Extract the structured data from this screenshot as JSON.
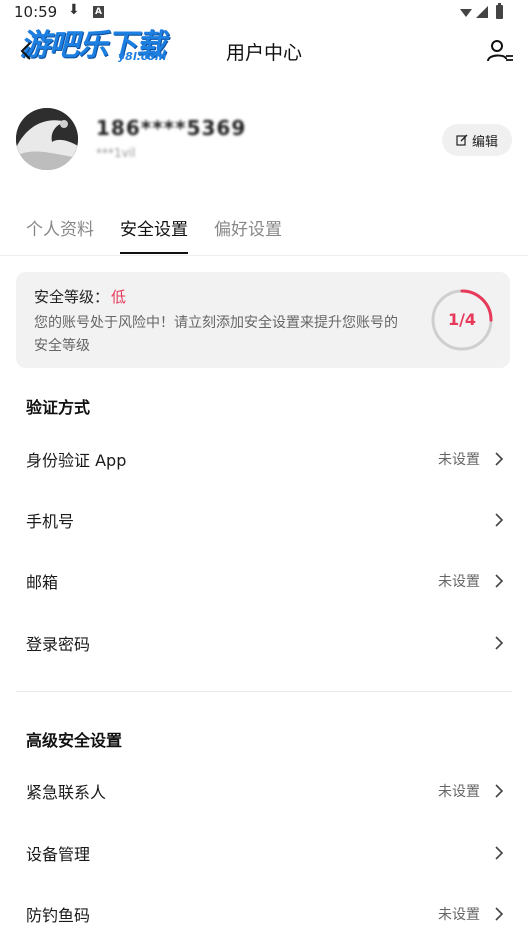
{
  "status_bar": {
    "time": "10:59",
    "download_icon": "download-icon",
    "notification_icon": "a-icon"
  },
  "watermark": {
    "main": "游吧乐下载",
    "sub": "y8l.com"
  },
  "header": {
    "title": "用户中心",
    "back_icon": "back-icon",
    "user_switch_icon": "user-switch-icon"
  },
  "profile": {
    "name": "186****5369",
    "sub": "***1vil",
    "edit_label": "编辑"
  },
  "tabs": [
    {
      "label": "个人资料",
      "active": false
    },
    {
      "label": "安全设置",
      "active": true
    },
    {
      "label": "偏好设置",
      "active": false
    }
  ],
  "security_level": {
    "label": "安全等级：",
    "value": "低",
    "description": "您的账号处于风险中！请立刻添加安全设置来提升您账号的安全等级",
    "score_text": "1/4",
    "score": 1,
    "score_max": 4
  },
  "verification": {
    "title": "验证方式",
    "items": [
      {
        "label": "身份验证 App",
        "value": "未设置"
      },
      {
        "label": "手机号",
        "value": ""
      },
      {
        "label": "邮箱",
        "value": "未设置"
      },
      {
        "label": "登录密码",
        "value": ""
      }
    ]
  },
  "advanced": {
    "title": "高级安全设置",
    "items": [
      {
        "label": "紧急联系人",
        "value": "未设置"
      },
      {
        "label": "设备管理",
        "value": ""
      },
      {
        "label": "防钓鱼码",
        "value": "未设置"
      }
    ]
  },
  "colors": {
    "accent": "#e8395a",
    "watermark": "#1d7fe0"
  }
}
